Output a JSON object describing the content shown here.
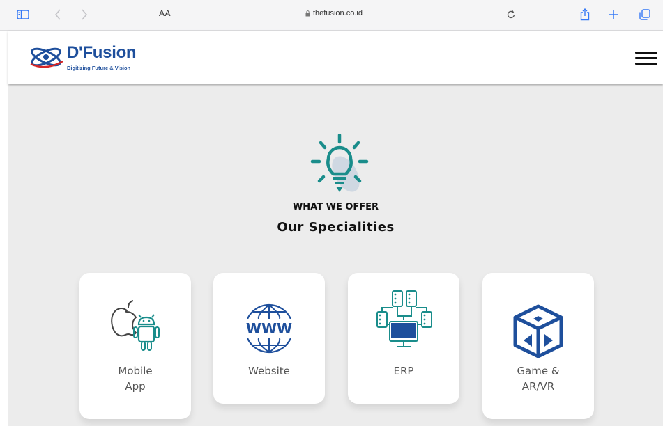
{
  "browser": {
    "text_size_label": "AA",
    "url": "thefusion.co.id"
  },
  "site": {
    "logo_name": "D'Fusion",
    "logo_tagline": "Digitizing Future & Vision"
  },
  "section": {
    "kicker": "WHAT WE OFFER",
    "heading": "Our Specialities"
  },
  "cards": [
    {
      "label": "Mobile\nApp",
      "icon": "apple-android-icon"
    },
    {
      "label": "Website",
      "icon": "www-globe-icon"
    },
    {
      "label": "ERP",
      "icon": "erp-network-icon"
    },
    {
      "label": "Game &\nAR/VR",
      "icon": "game-cube-icon"
    }
  ],
  "colors": {
    "brand": "#1e4f9c",
    "accent": "#1a8d8b",
    "page_bg": "#ececec"
  }
}
